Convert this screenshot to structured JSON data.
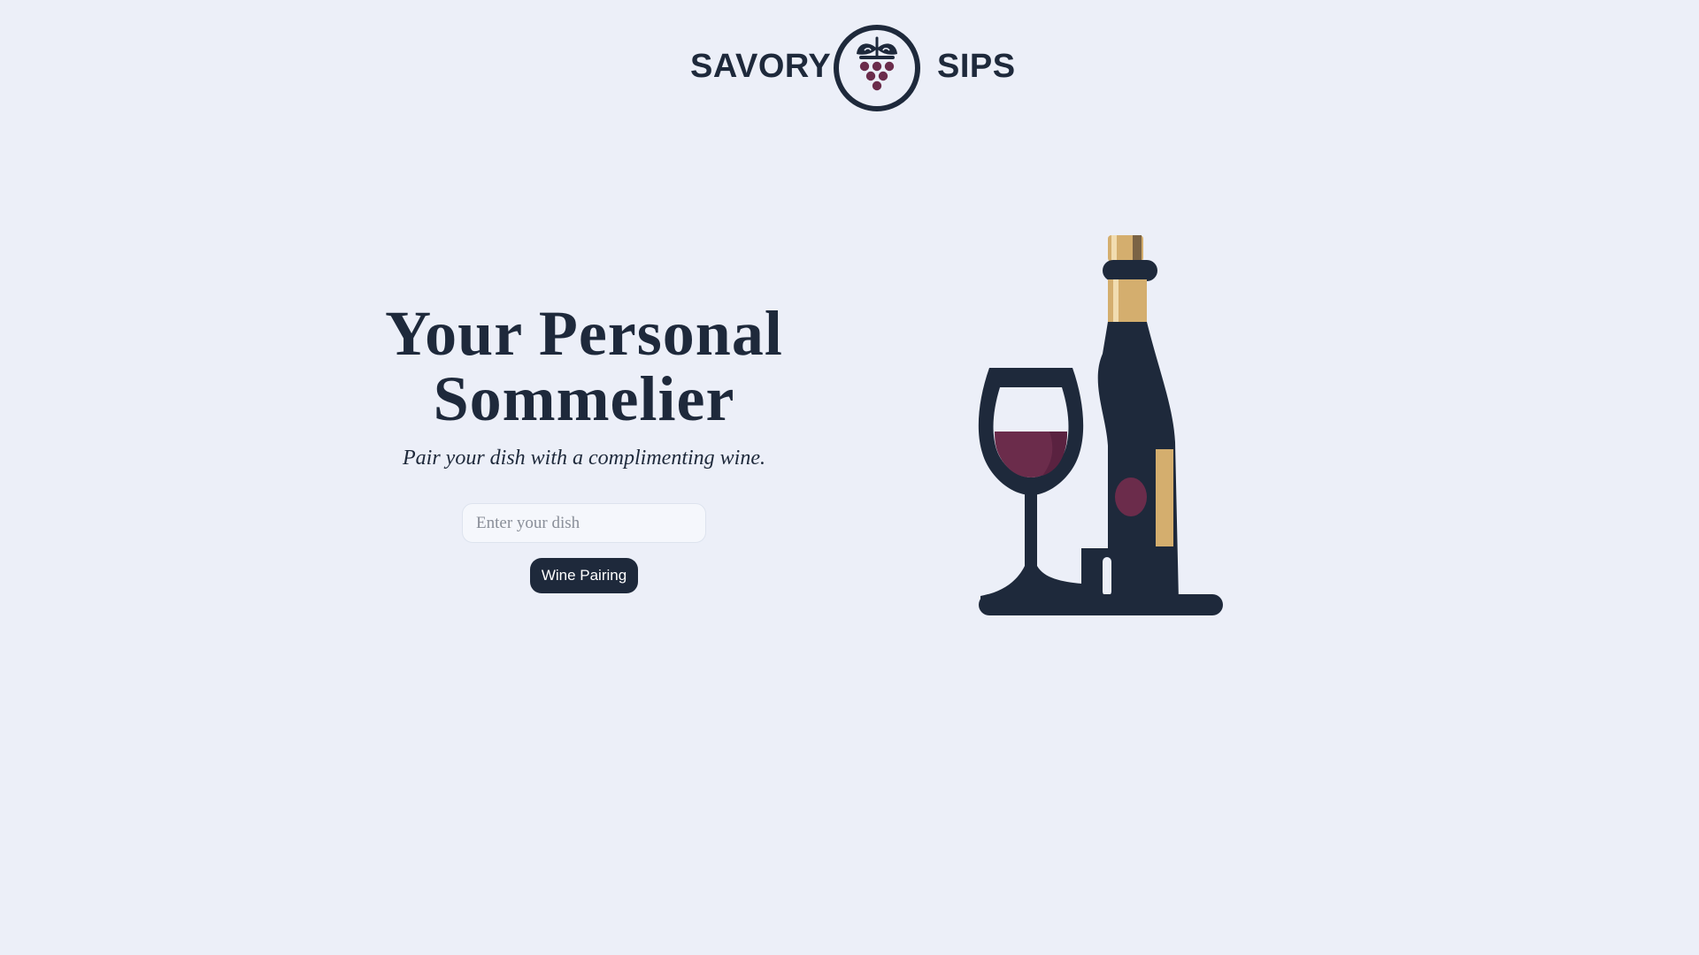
{
  "brand": {
    "left_word": "SAVORY",
    "right_word": "SIPS",
    "logo_icon": "grape-cluster-icon"
  },
  "hero": {
    "title_line1": "Your Personal",
    "title_line2": "Sommelier",
    "subtitle": "Pair your dish with a complimenting wine."
  },
  "form": {
    "dish_value": "",
    "dish_placeholder": "Enter your dish",
    "submit_label": "Wine Pairing"
  },
  "illustration": {
    "icon": "wine-bottle-and-glass-icon"
  },
  "colors": {
    "background": "#ECEFF8",
    "navy": "#1E293B",
    "wine": "#6B2C4B",
    "gold": "#D4AE6E"
  }
}
